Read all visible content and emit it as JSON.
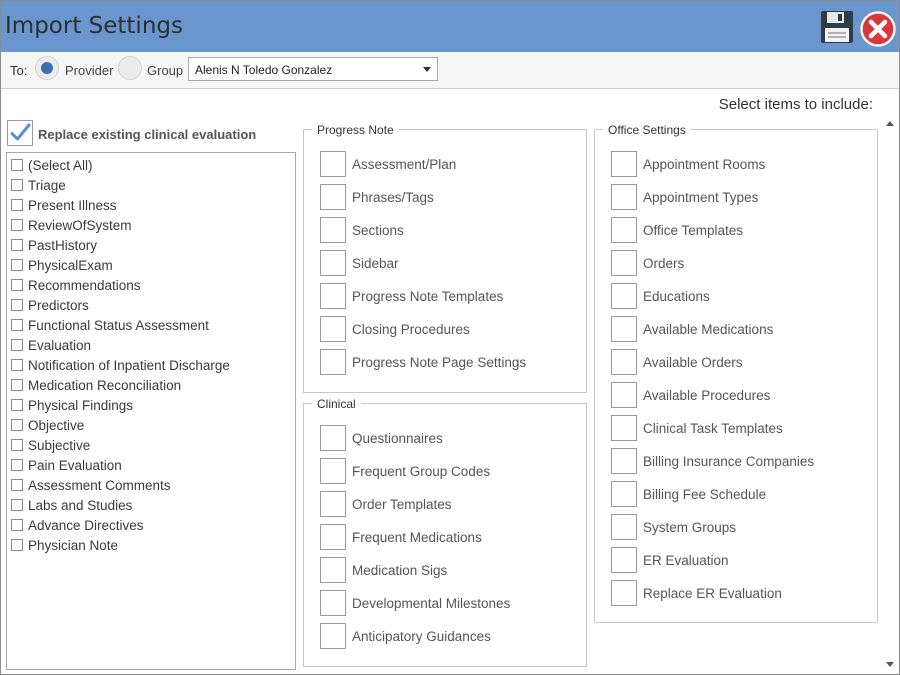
{
  "window": {
    "title": "Import Settings",
    "accent_color": "#6996cc",
    "icons": {
      "save": "save-icon",
      "close": "close-icon"
    }
  },
  "to_bar": {
    "to_label": "To:",
    "radio_provider_label": "Provider",
    "radio_group_label": "Group",
    "selected_radio": "Provider",
    "provider_select_value": "Alenis N Toledo Gonzalez"
  },
  "select_hint": "Select items to include:",
  "replace_existing": {
    "label": "Replace existing clinical evaluation",
    "checked": true
  },
  "left_list": {
    "items": [
      "(Select All)",
      "Triage",
      "Present Illness",
      "ReviewOfSystem",
      "PastHistory",
      "PhysicalExam",
      "Recommendations",
      "Predictors",
      "Functional Status Assessment",
      "Evaluation",
      "Notification of Inpatient Discharge",
      "Medication Reconciliation",
      "Physical Findings",
      "Objective",
      "Subjective",
      "Pain Evaluation",
      "Assessment Comments",
      "Labs and Studies",
      "Advance Directives",
      "Physician Note"
    ]
  },
  "groups": {
    "progress_note": {
      "title": "Progress Note",
      "items": [
        "Assessment/Plan",
        "Phrases/Tags",
        "Sections",
        "Sidebar",
        "Progress Note Templates",
        "Closing Procedures",
        "Progress Note Page Settings"
      ]
    },
    "clinical": {
      "title": "Clinical",
      "items": [
        "Questionnaires",
        "Frequent Group Codes",
        "Order Templates",
        "Frequent Medications",
        "Medication Sigs",
        "Developmental Milestones",
        "Anticipatory Guidances"
      ]
    },
    "office_settings": {
      "title": "Office Settings",
      "items": [
        "Appointment Rooms",
        "Appointment Types",
        "Office Templates",
        "Orders",
        "Educations",
        "Available Medications",
        "Available Orders",
        "Available Procedures",
        "Clinical Task Templates",
        "Billing Insurance Companies",
        "Billing Fee Schedule",
        "System Groups",
        "ER Evaluation",
        "Replace ER Evaluation"
      ]
    }
  }
}
